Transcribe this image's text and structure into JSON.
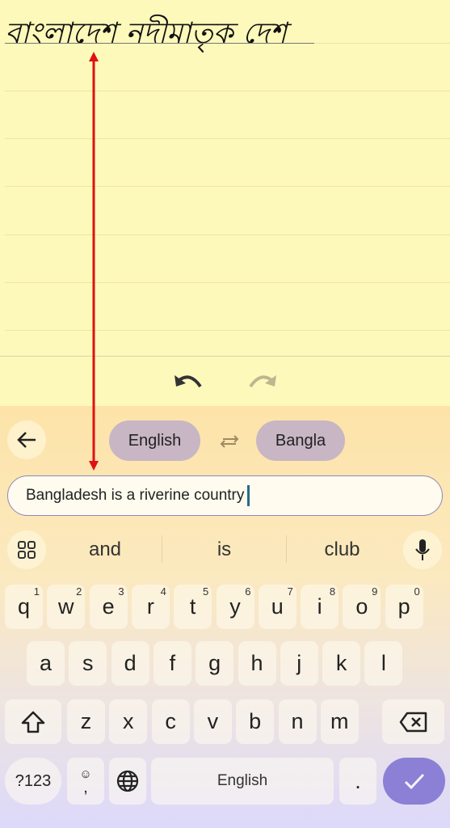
{
  "note": {
    "handwriting": "বাংলাদেশ নদীমাতৃক দেশ"
  },
  "toolbar": {
    "undo_icon": "undo-icon",
    "redo_icon": "redo-icon"
  },
  "translate": {
    "source_lang": "English",
    "target_lang": "Bangla",
    "swap_icon": "swap-icon",
    "back_icon": "arrow-left-icon"
  },
  "input": {
    "value": "Bangladesh is a riverine country"
  },
  "suggestions": [
    "and",
    "is",
    "club"
  ],
  "keyboard": {
    "row1": [
      {
        "k": "q",
        "n": "1"
      },
      {
        "k": "w",
        "n": "2"
      },
      {
        "k": "e",
        "n": "3"
      },
      {
        "k": "r",
        "n": "4"
      },
      {
        "k": "t",
        "n": "5"
      },
      {
        "k": "y",
        "n": "6"
      },
      {
        "k": "u",
        "n": "7"
      },
      {
        "k": "i",
        "n": "8"
      },
      {
        "k": "o",
        "n": "9"
      },
      {
        "k": "p",
        "n": "0"
      }
    ],
    "row2": [
      "a",
      "s",
      "d",
      "f",
      "g",
      "h",
      "j",
      "k",
      "l"
    ],
    "row3": [
      "z",
      "x",
      "c",
      "v",
      "b",
      "n",
      "m"
    ],
    "symbols": "?123",
    "comma": ",",
    "space": "English",
    "period": ".",
    "colors": {
      "enter": "#8b80d6",
      "accent_pill": "#c8b6c5"
    }
  },
  "annotation": {
    "arrow_color": "#e01010"
  }
}
